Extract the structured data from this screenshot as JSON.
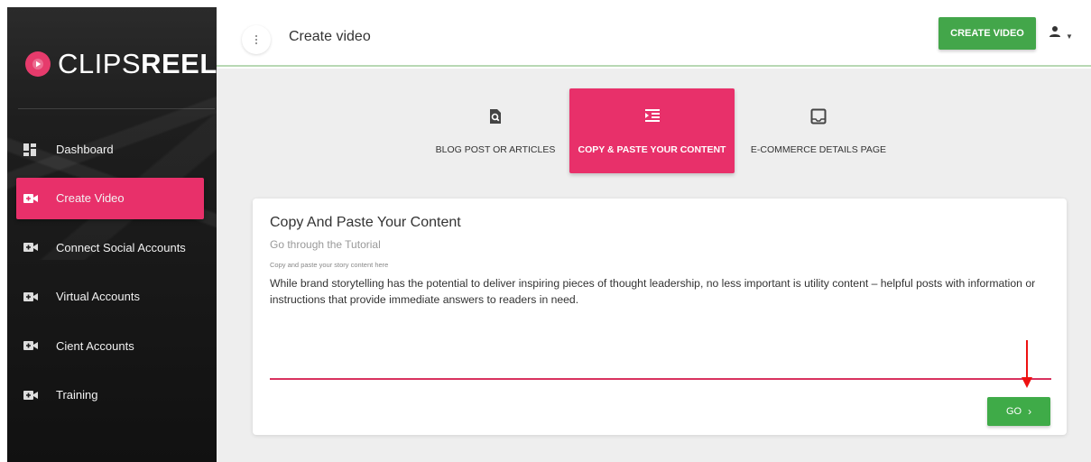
{
  "brand": {
    "name_light": "CLIPS",
    "name_bold": "REEL",
    "accent": "#e8306a",
    "green": "#43a64a"
  },
  "sidebar": {
    "items": [
      {
        "label": "Dashboard",
        "icon": "dashboard-icon",
        "active": false
      },
      {
        "label": "Create Video",
        "icon": "video-add-icon",
        "active": true
      },
      {
        "label": "Connect Social Accounts",
        "icon": "video-add-icon",
        "active": false
      },
      {
        "label": "Virtual Accounts",
        "icon": "video-add-icon",
        "active": false
      },
      {
        "label": "Cient Accounts",
        "icon": "video-add-icon",
        "active": false
      },
      {
        "label": "Training",
        "icon": "video-add-icon",
        "active": false
      }
    ]
  },
  "header": {
    "menu_icon": "more-vert-icon",
    "title": "Create video",
    "create_button": "CREATE VIDEO",
    "user_icon": "person-icon",
    "caret_icon": "caret-down-icon"
  },
  "tabs": [
    {
      "label": "BLOG POST OR ARTICLES",
      "icon": "blog-search-icon",
      "active": false
    },
    {
      "label": "COPY & PASTE YOUR CONTENT",
      "icon": "paste-list-icon",
      "active": true
    },
    {
      "label": "E-COMMERCE DETAILS PAGE",
      "icon": "inbox-icon",
      "active": false
    }
  ],
  "card": {
    "title": "Copy And Paste Your Content",
    "subtitle": "Go through the Tutorial",
    "field_label": "Copy and paste your story content here",
    "field_text": "While brand storytelling has the potential to deliver inspiring pieces of thought leadership, no less important is utility content – helpful posts with information or instructions that provide immediate answers to readers in need.",
    "go_button": "GO",
    "go_icon": "chevron-right-icon"
  }
}
